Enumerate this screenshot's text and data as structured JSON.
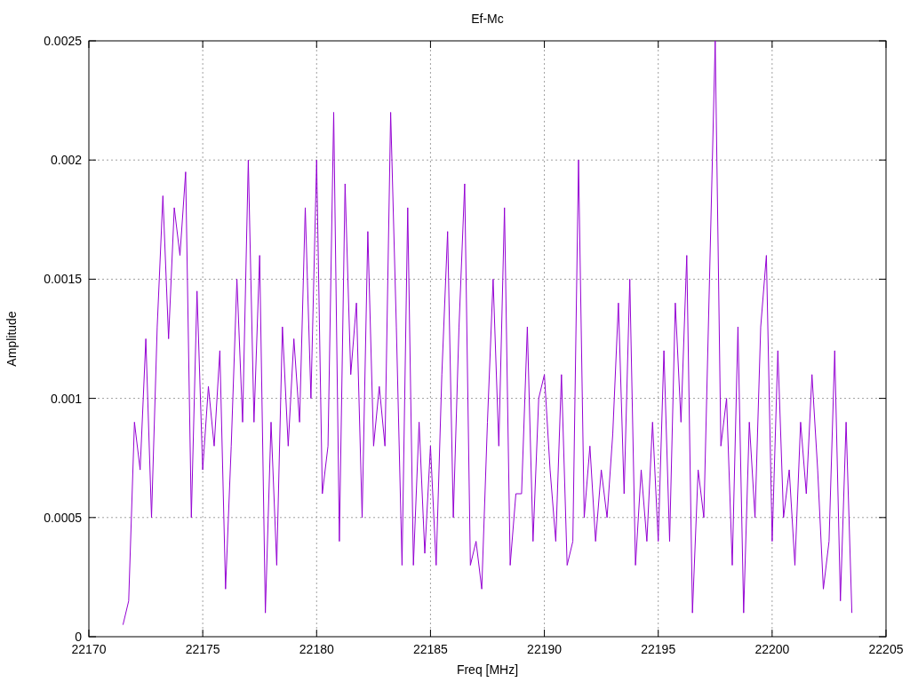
{
  "chart_data": {
    "type": "line",
    "title": "Ef-Mc",
    "xlabel": "Freq [MHz]",
    "ylabel": "Amplitude",
    "x": [
      22171.5,
      22171.75,
      22172,
      22172.25,
      22172.5,
      22172.75,
      22173,
      22173.25,
      22173.5,
      22173.75,
      22174,
      22174.25,
      22174.5,
      22174.75,
      22175,
      22175.25,
      22175.5,
      22175.75,
      22176,
      22176.25,
      22176.5,
      22176.75,
      22177,
      22177.25,
      22177.5,
      22177.75,
      22178,
      22178.25,
      22178.5,
      22178.75,
      22179,
      22179.25,
      22179.5,
      22179.75,
      22180,
      22180.25,
      22180.5,
      22180.75,
      22181,
      22181.25,
      22181.5,
      22181.75,
      22182,
      22182.25,
      22182.5,
      22182.75,
      22183,
      22183.25,
      22183.5,
      22183.75,
      22184,
      22184.25,
      22184.5,
      22184.75,
      22185,
      22185.25,
      22185.5,
      22185.75,
      22186,
      22186.25,
      22186.5,
      22186.75,
      22187,
      22187.25,
      22187.5,
      22187.75,
      22188,
      22188.25,
      22188.5,
      22188.75,
      22189,
      22189.25,
      22189.5,
      22189.75,
      22190,
      22190.25,
      22190.5,
      22190.75,
      22191,
      22191.25,
      22191.5,
      22191.75,
      22192,
      22192.25,
      22192.5,
      22192.75,
      22193,
      22193.25,
      22193.5,
      22193.75,
      22194,
      22194.25,
      22194.5,
      22194.75,
      22195,
      22195.25,
      22195.5,
      22195.75,
      22196,
      22196.25,
      22196.5,
      22196.75,
      22197,
      22197.25,
      22197.5,
      22197.75,
      22198,
      22198.25,
      22198.5,
      22198.75,
      22199,
      22199.25,
      22199.5,
      22199.75,
      22200,
      22200.25,
      22200.5,
      22200.75,
      22201,
      22201.25,
      22201.5,
      22201.75,
      22202,
      22202.25,
      22202.5,
      22202.75,
      22203,
      22203.25,
      22203.5
    ],
    "grid": true,
    "series": [
      {
        "color": "#9400d3",
        "values": [
          5e-05,
          0.00015,
          0.0009,
          0.0007,
          0.00125,
          0.0005,
          0.0013,
          0.00185,
          0.00125,
          0.0018,
          0.0016,
          0.00195,
          0.0005,
          0.00145,
          0.0007,
          0.00105,
          0.0008,
          0.0012,
          0.0002,
          0.0008,
          0.0015,
          0.0009,
          0.002,
          0.0009,
          0.0016,
          0.0001,
          0.0009,
          0.0003,
          0.0013,
          0.0008,
          0.00125,
          0.0009,
          0.0018,
          0.001,
          0.002,
          0.0006,
          0.0008,
          0.0022,
          0.0004,
          0.0019,
          0.0011,
          0.0014,
          0.0005,
          0.0017,
          0.0008,
          0.00105,
          0.0008,
          0.0022,
          0.0013,
          0.0003,
          0.0018,
          0.0003,
          0.0009,
          0.00035,
          0.0008,
          0.0003,
          0.0011,
          0.0017,
          0.0005,
          0.0013,
          0.0019,
          0.0003,
          0.0004,
          0.0002,
          0.0009,
          0.0015,
          0.0008,
          0.0018,
          0.0003,
          0.0006,
          0.0006,
          0.0013,
          0.0004,
          0.001,
          0.0011,
          0.0007,
          0.0004,
          0.0011,
          0.0003,
          0.0004,
          0.002,
          0.0005,
          0.0008,
          0.0004,
          0.0007,
          0.0005,
          0.00085,
          0.0014,
          0.0006,
          0.0015,
          0.0003,
          0.0007,
          0.0004,
          0.0009,
          0.0004,
          0.0012,
          0.0004,
          0.0014,
          0.0009,
          0.0016,
          0.0001,
          0.0007,
          0.0005,
          0.0015,
          0.0025,
          0.0008,
          0.001,
          0.0003,
          0.0013,
          0.0001,
          0.0009,
          0.0005,
          0.0013,
          0.0016,
          0.0004,
          0.0012,
          0.0005,
          0.0007,
          0.0003,
          0.0009,
          0.0006,
          0.0011,
          0.0007,
          0.0002,
          0.0004,
          0.0012,
          0.00015,
          0.0009,
          0.0001
        ]
      }
    ],
    "xlim": [
      22170,
      22205
    ],
    "ylim": [
      0,
      0.0025
    ],
    "xticks": [
      22170,
      22175,
      22180,
      22185,
      22190,
      22195,
      22200,
      22205
    ],
    "yticks": [
      {
        "value": 0,
        "label": "0"
      },
      {
        "value": 0.0005,
        "label": "0.0005"
      },
      {
        "value": 0.001,
        "label": "0.001"
      },
      {
        "value": 0.0015,
        "label": "0.0015"
      },
      {
        "value": 0.002,
        "label": "0.002"
      },
      {
        "value": 0.0025,
        "label": "0.0025"
      }
    ]
  }
}
